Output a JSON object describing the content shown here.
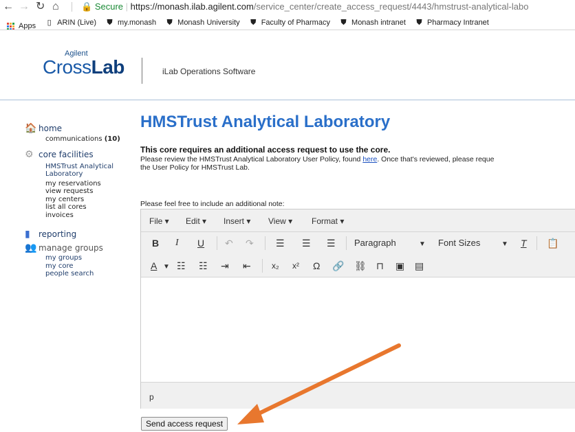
{
  "browser": {
    "secure_label": "Secure",
    "url_host": "https://monash.ilab.agilent.com",
    "url_path": "/service_center/create_access_request/4443/hmstrust-analytical-labo",
    "bookmarks": [
      {
        "label": "Apps",
        "icon": "apps-grid-icon"
      },
      {
        "label": "ARIN (Live)",
        "icon": "page-icon"
      },
      {
        "label": "my.monash",
        "icon": "monash-shield-icon"
      },
      {
        "label": "Monash University",
        "icon": "monash-shield-icon"
      },
      {
        "label": "Faculty of Pharmacy",
        "icon": "monash-shield-icon"
      },
      {
        "label": "Monash intranet",
        "icon": "monash-shield-icon"
      },
      {
        "label": "Pharmacy Intranet",
        "icon": "monash-shield-icon"
      }
    ]
  },
  "header": {
    "logo_small": "Agilent",
    "logo_cross": "Cross",
    "logo_lab": "Lab",
    "title": "iLab Operations Software"
  },
  "sidebar": {
    "home": "home",
    "communications": "communications",
    "communications_count": "(10)",
    "core_facilities": "core facilities",
    "core_items": [
      "HMSTrust Analytical Laboratory"
    ],
    "links": [
      "my reservations",
      "view requests",
      "my centers",
      "list all cores",
      "invoices"
    ],
    "reporting": "reporting",
    "manage_groups": "manage groups",
    "group_links": [
      "my groups",
      "my core",
      "people search"
    ]
  },
  "main": {
    "title": "HMSTrust Analytical Laboratory",
    "notice": "This core requires an additional access request to use the core.",
    "review_before": "Please review the HMSTrust Analytical Laboratory User Policy, found ",
    "review_link": "here",
    "review_after": ".  Once that's reviewed, please reque",
    "review_line2": "the User Policy for HMSTrust Lab.",
    "note_label": "Please feel free to include an additional note:"
  },
  "editor": {
    "menus": [
      "File",
      "Edit",
      "Insert",
      "View",
      "Format"
    ],
    "paragraph_label": "Paragraph",
    "font_sizes_label": "Font Sizes",
    "status_path": "p"
  },
  "actions": {
    "send_label": "Send access request"
  },
  "colors": {
    "title_blue": "#2a6fc9",
    "arrow_orange": "#e8772e",
    "secure_green": "#1a8a35"
  }
}
